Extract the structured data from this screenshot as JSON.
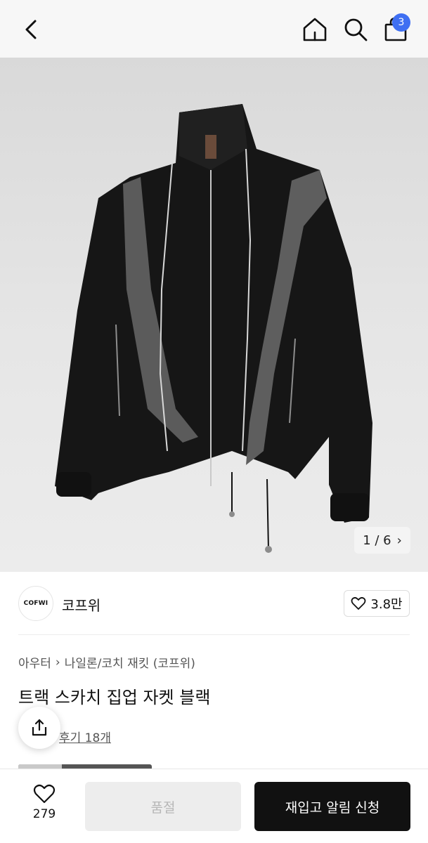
{
  "header": {
    "cart_count": "3"
  },
  "gallery": {
    "counter_label": "1 / 6",
    "chevron": "›"
  },
  "brand": {
    "logo_text": "COFWI",
    "name": "코프위",
    "like_count": "3.8만"
  },
  "product": {
    "breadcrumb": [
      "아우터",
      "나일론/코치 재킷 (코프위)"
    ],
    "breadcrumb_separator": "›",
    "title": "트랙 스카치 집업 자켓 블랙",
    "review_text": "후기 18개"
  },
  "bottom_bar": {
    "wish_count": "279",
    "soldout_label": "품절",
    "notify_label": "재입고 알림 신청"
  },
  "icons": {
    "back": "chevron-left-icon",
    "home": "home-icon",
    "search": "search-icon",
    "bag": "shopping-bag-icon",
    "heart": "heart-icon",
    "share": "share-icon",
    "star": "star-icon"
  },
  "colors": {
    "accent_badge": "#3f6ff2",
    "primary_button": "#111111",
    "disabled_button": "#ededed"
  }
}
